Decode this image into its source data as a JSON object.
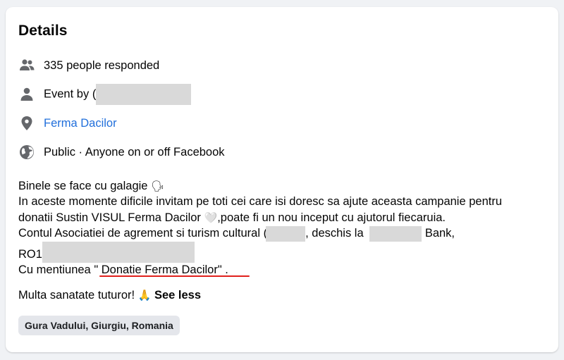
{
  "details": {
    "title": "Details",
    "responded": "335 people responded",
    "event_by_prefix": "Event by",
    "event_by_partial": "(",
    "location": "Ferma Dacilor",
    "privacy": "Public · Anyone on or off Facebook"
  },
  "description": {
    "line1_text": "Binele se face cu galagie",
    "line1_emoji": "🗣",
    "line2": "In aceste momente dificile invitam pe toti cei care isi doresc sa ajute aceasta campanie pentru",
    "line3_a": "donatii Sustin VISUL Ferma Dacilor",
    "line3_emoji": "🤍",
    "line3_b": ",poate fi un nou inceput cu ajutorul fiecaruia.",
    "line4_a": "Contul Asociatiei de agrement si turism cultural",
    "line4_partial": "(",
    "line4_b": ", deschis la",
    "line4_c": "Bank,",
    "iban_prefix": "RO1",
    "line6_a": "Cu mentiunea",
    "line6_quote": "\" Donatie Ferma Dacilor\" .",
    "line7_text": "Multa sanatate tuturor!",
    "line7_emoji": "🙏",
    "see_less": "See less"
  },
  "tag": {
    "label": "Gura Vadului, Giurgiu, Romania"
  },
  "icons": [
    "people-icon",
    "person-icon",
    "location-pin-icon",
    "globe-icon"
  ],
  "colors": {
    "link": "#216fdb",
    "icon": "#65676b",
    "underline": "#e0201c",
    "redaction": "#d9d9d9"
  }
}
